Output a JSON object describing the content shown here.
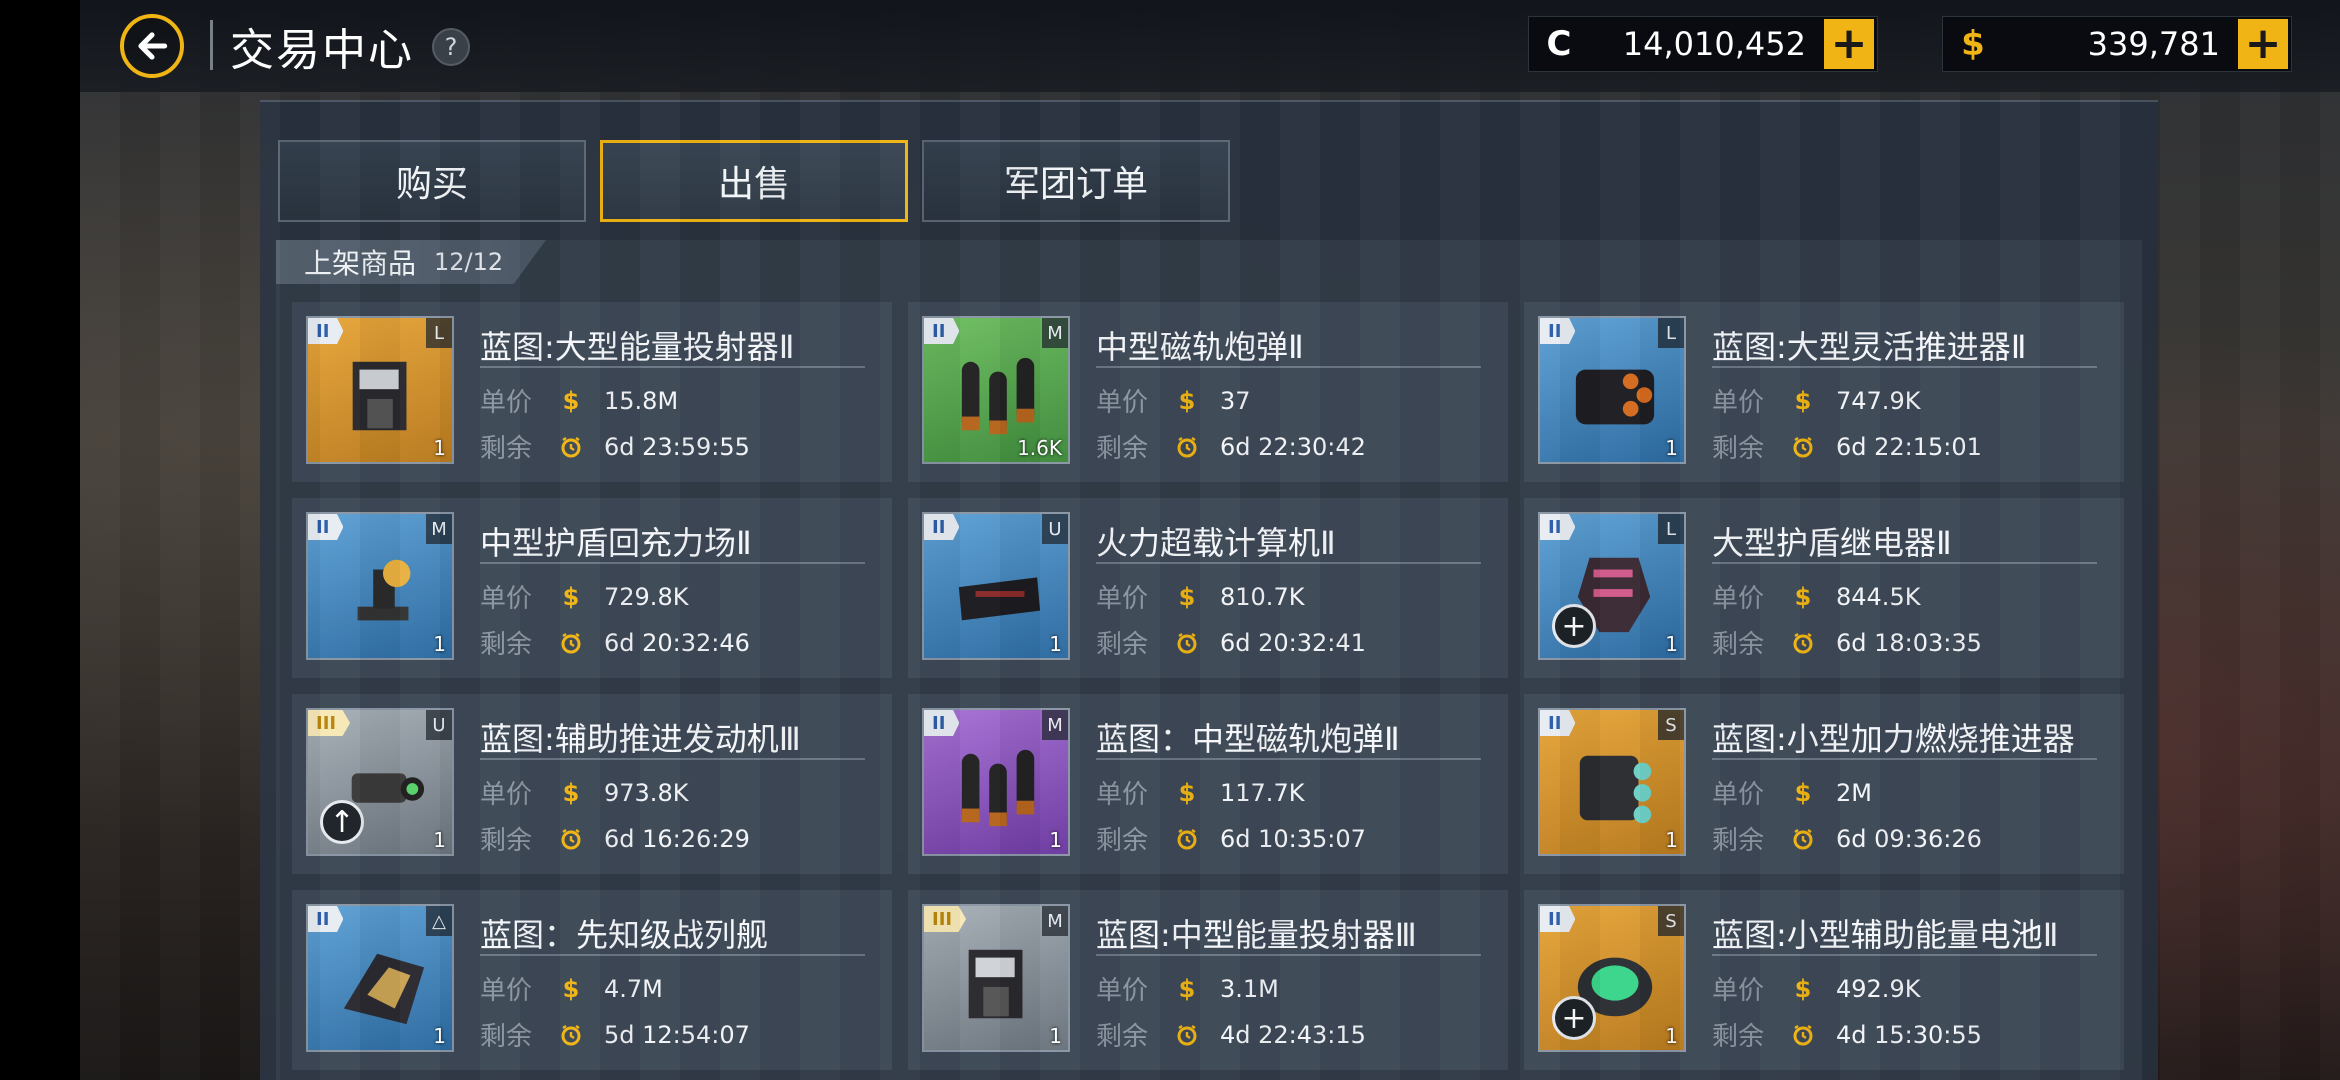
{
  "header": {
    "title": "交易中心",
    "help": "?",
    "currency_c": {
      "symbol": "C",
      "value": "14,010,452",
      "plus": "+"
    },
    "currency_s": {
      "symbol": "$",
      "value": "339,781",
      "plus": "+"
    }
  },
  "tabs": [
    {
      "label": "购买",
      "active": false
    },
    {
      "label": "出售",
      "active": true
    },
    {
      "label": "军团订单",
      "active": false
    }
  ],
  "section": {
    "label": "上架商品",
    "count": "12/12"
  },
  "labels": {
    "price": "单价",
    "remaining": "剩余"
  },
  "colors": {
    "accent": "#f0b514",
    "panel": "#28323e",
    "text": "#f5f7fa",
    "muted": "#8c97a3"
  },
  "items": [
    {
      "name": "蓝图:大型能量投射器Ⅱ",
      "price": "15.8M",
      "time": "6d 23:59:55",
      "tier": "II",
      "size": "L",
      "qty": "1",
      "bg": "orange"
    },
    {
      "name": "中型磁轨炮弹Ⅱ",
      "price": "37",
      "time": "6d 22:30:42",
      "tier": "II",
      "size": "M",
      "qty": "1.6K",
      "bg": "green"
    },
    {
      "name": "蓝图:大型灵活推进器Ⅱ",
      "price": "747.9K",
      "time": "6d 22:15:01",
      "tier": "II",
      "size": "L",
      "qty": "1",
      "bg": "blue"
    },
    {
      "name": "中型护盾回充力场Ⅱ",
      "price": "729.8K",
      "time": "6d 20:32:46",
      "tier": "II",
      "size": "M",
      "qty": "1",
      "bg": "blue"
    },
    {
      "name": "火力超载计算机Ⅱ",
      "price": "810.7K",
      "time": "6d 20:32:41",
      "tier": "II",
      "size": "U",
      "qty": "1",
      "bg": "blue"
    },
    {
      "name": "大型护盾继电器Ⅱ",
      "price": "844.5K",
      "time": "6d 18:03:35",
      "tier": "II",
      "size": "L",
      "qty": "1",
      "bg": "blue"
    },
    {
      "name": "蓝图:辅助推进发动机Ⅲ",
      "price": "973.8K",
      "time": "6d 16:26:29",
      "tier": "III",
      "size": "U",
      "qty": "1",
      "bg": "grey"
    },
    {
      "name": "蓝图：中型磁轨炮弹Ⅱ",
      "price": "117.7K",
      "time": "6d 10:35:07",
      "tier": "II",
      "size": "M",
      "qty": "1",
      "bg": "purple"
    },
    {
      "name": "蓝图:小型加力燃烧推进器",
      "price": "2M",
      "time": "6d 09:36:26",
      "tier": "II",
      "size": "S",
      "qty": "1",
      "bg": "orange"
    },
    {
      "name": "蓝图：先知级战列舰",
      "price": "4.7M",
      "time": "5d 12:54:07",
      "tier": "II",
      "size": "△",
      "qty": "1",
      "bg": "blue"
    },
    {
      "name": "蓝图:中型能量投射器Ⅲ",
      "price": "3.1M",
      "time": "4d 22:43:15",
      "tier": "III",
      "size": "M",
      "qty": "1",
      "bg": "grey"
    },
    {
      "name": "蓝图:小型辅助能量电池Ⅱ",
      "price": "492.9K",
      "time": "4d 15:30:55",
      "tier": "II",
      "size": "S",
      "qty": "1",
      "bg": "orange"
    }
  ]
}
